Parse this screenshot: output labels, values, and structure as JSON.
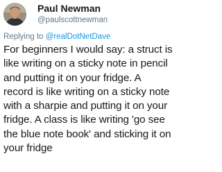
{
  "author": {
    "display_name": "Paul Newman",
    "handle": "@paulscottnewman",
    "avatar_icon": "user-avatar-photo"
  },
  "reply": {
    "prefix": "Replying to",
    "to": "@realDotNetDave"
  },
  "tweet": {
    "text": "For beginners I would say: a struct is\nlike writing on a sticky note in pencil\nand putting it on your fridge. A\nrecord is like writing on a sticky note\nwith a sharpie and putting it on your\nfridge. A class is like writing 'go see\nthe blue note book' and sticking it on\nyour fridge"
  },
  "colors": {
    "text": "#14171a",
    "secondary": "#657786",
    "link": "#1b95e0"
  }
}
